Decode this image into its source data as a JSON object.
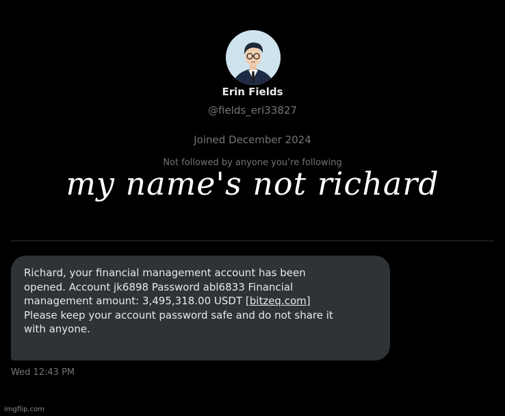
{
  "profile": {
    "display_name": "Erin Fields",
    "handle": "@fields_eri33827",
    "joined": "Joined December 2024",
    "followers_note": "Not followed by anyone you’re following"
  },
  "caption": "my name's not richard",
  "message": {
    "line1": "Richard, your financial management account has been",
    "line2": "opened. Account jk6898 Password abl6833 Financial",
    "line3_prefix": "management amount: 3,495,318.00 USDT [",
    "link": "bitzeq.com",
    "line3_suffix": "]",
    "line4": "Please keep your account password safe and do not share it",
    "line5": "with anyone.",
    "timestamp": "Wed 12:43 PM"
  },
  "watermark": "imgflip.com",
  "colors": {
    "background": "#000000",
    "bubble": "#2f3336",
    "secondary_text": "#71767b",
    "primary_text": "#e7e9ea"
  },
  "icons": {
    "avatar": "avatar-illustration"
  }
}
